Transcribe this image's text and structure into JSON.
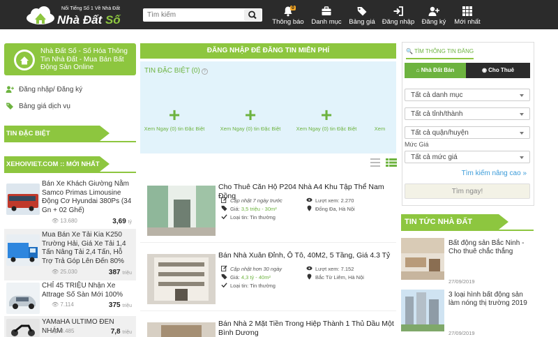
{
  "header": {
    "tagline": "Nổi Tiếng Số 1 Về Nhà Đất",
    "brand_main": "Nhà Đất",
    "brand_accent": "Số",
    "search_placeholder": "Tìm kiếm",
    "nav": [
      {
        "label": "Thông báo",
        "icon": "bell-icon",
        "badge": "0"
      },
      {
        "label": "Danh mục",
        "icon": "briefcase-icon"
      },
      {
        "label": "Bảng giá",
        "icon": "tags-icon"
      },
      {
        "label": "Đăng nhập",
        "icon": "sign-in-icon"
      },
      {
        "label": "Đăng ký",
        "icon": "user-plus-icon"
      },
      {
        "label": "Mới nhất",
        "icon": "grid-icon"
      }
    ]
  },
  "sidebar": {
    "card_text": "Nhà Đất Số - Số Hóa Thông Tin Nhà Đất - Mua Bán Bất Động Sản Online",
    "login_label": "Đăng nhập/ Đăng ký",
    "price_label": "Bảng giá dịch vụ",
    "special_title": "TIN ĐẶC BIỆT",
    "xehoi_title": "XEHOIVIET.COM :: MỚI NHẤT",
    "listings": [
      {
        "title": "Bán Xe Khách Giường Nằm Samco Primas Limousine Động Cơ Hyundai 380Ps (34 Gn + 02 Ghế)",
        "views": "13.680",
        "price": "3,69",
        "unit": "tỷ"
      },
      {
        "title": "Mua Bán Xe Tải Kia K250 Trường Hải, Giá Xe Tải 1,4 Tấn Nâng Tải 2,4 Tấn, Hỗ Trợ Trả Góp Lên Đến 80%",
        "views": "25.030",
        "price": "387",
        "unit": "triệu"
      },
      {
        "title": "CHỈ 45 TRIỆU Nhận Xe Attrage Số Sàn Mới 100%",
        "views": "7.114",
        "price": "375",
        "unit": "triệu"
      },
      {
        "title": "YAMaHA ULTIMO ĐEN NHÁM",
        "views": "8.485",
        "price": "7,8",
        "unit": "triệu"
      }
    ]
  },
  "center": {
    "banner": "ĐĂNG NHẬP ĐỂ ĐĂNG TIN MIỄN PHÍ",
    "special_heading": "TIN ĐẶC BIỆT (0)",
    "special_help": "?",
    "plus_glyph": "+",
    "placeholders": [
      "Xem Ngay (0) tin Đặc Biệt",
      "Xem Ngay (0) tin Đặc Biệt",
      "Xem Ngay (0) tin Đặc Biệt",
      "Xem"
    ],
    "items": [
      {
        "title": "Cho Thuê Căn Hộ P204 Nhà A4 Khu Tập Thể Nam Đồng",
        "updated": "Cập nhật 7 ngày trước",
        "views": "Lượt xem: 2.270",
        "price_prefix": "Giá:",
        "price": "3,5",
        "price_unit": "triệu - 30m²",
        "location": "Đống Đa, Hà Nội",
        "type": "Loại tin: Tin thường"
      },
      {
        "title": "Bán Nhà Xuân Đỉnh, Ô Tô, 40M2, 5 Tầng, Giá 4.3 Tỷ",
        "updated": "Cập nhật hơn 30 ngày",
        "views": "Lượt xem: 7.152",
        "price_prefix": "Giá:",
        "price": "4,3",
        "price_unit": "tỷ - 40m²",
        "location": "Bắc Từ Liêm, Hà Nội",
        "type": "Loại tin: Tin thường"
      },
      {
        "title": "Bán Nhà 2 Mặt Tiền Trong Hiệp Thành 1 Thủ Dầu Một Bình Dương"
      }
    ]
  },
  "right": {
    "search_title": "TÌM THÔNG TIN ĐĂNG",
    "tab_sell": "Nhà Đất Bán",
    "tab_rent": "Cho Thuê",
    "select_category": "Tất cả danh mục",
    "select_province": "Tất cả tỉnh/thành",
    "select_district": "Tất cả quận/huyện",
    "price_label": "Mức Giá",
    "select_price": "Tất cả mức giá",
    "advanced": "Tìm kiếm nâng cao",
    "search_button": "Tìm ngay!",
    "news_title": "TIN TỨC NHÀ ĐẤT",
    "news": [
      {
        "title": "Bất động sản Bắc Ninh - Cho thuê chắc thắng",
        "date": "27/09/2019"
      },
      {
        "title": "3 loại hình bất động sản làm nóng thị trường 2019",
        "date": "27/09/2019"
      }
    ]
  },
  "colors": {
    "accent": "#8dc63f",
    "topbar": "#2b2b2b",
    "special_bg": "#e2f3fb",
    "link": "#3a9bd9"
  }
}
